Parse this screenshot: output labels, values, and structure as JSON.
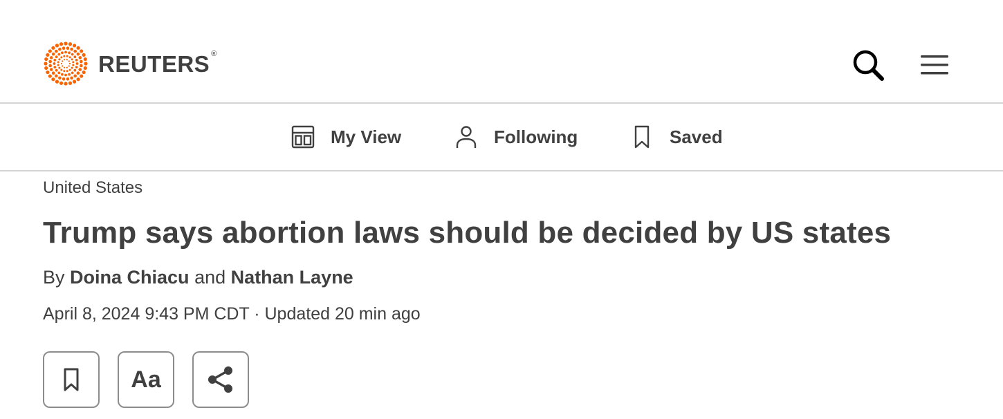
{
  "header": {
    "logo_text": "REUTERS",
    "logo_mark": "®",
    "brand_color": "#fa6400",
    "search_icon": "search-icon",
    "menu_icon": "hamburger-menu-icon"
  },
  "subnav": {
    "items": [
      {
        "label": "My View",
        "icon": "layout-icon"
      },
      {
        "label": "Following",
        "icon": "person-icon"
      },
      {
        "label": "Saved",
        "icon": "bookmark-icon"
      }
    ]
  },
  "article": {
    "kicker": "United States",
    "headline": "Trump says abortion laws should be decided by US states",
    "byline": {
      "prefix": "By",
      "author1": "Doina Chiacu",
      "conjunction": "and",
      "author2": "Nathan Layne"
    },
    "dateline": "April 8, 2024 9:43 PM CDT · Updated 20 min ago"
  },
  "tools": {
    "bookmark_icon": "bookmark-icon",
    "text_size_label": "Aa",
    "share_icon": "share-icon"
  }
}
